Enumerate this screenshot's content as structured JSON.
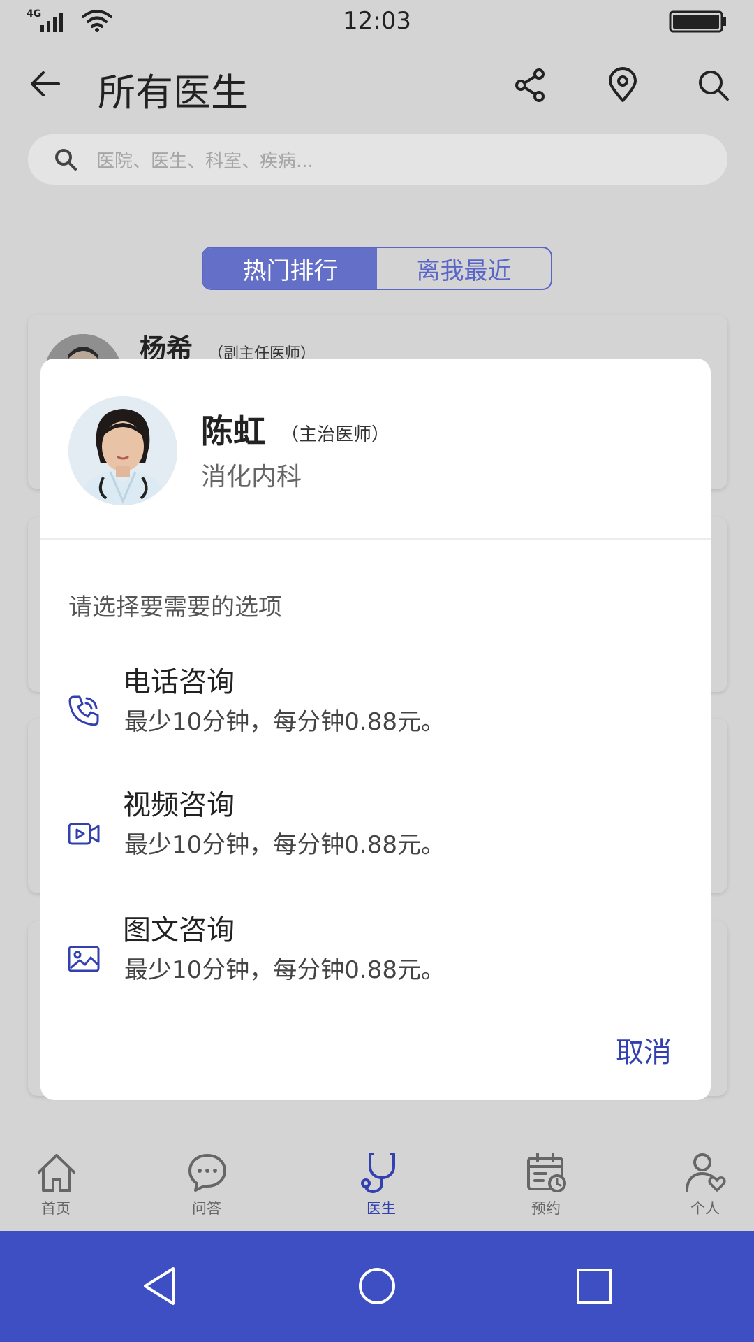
{
  "status_bar": {
    "time": "12:03",
    "network": "4G"
  },
  "header": {
    "title": "所有医生"
  },
  "search": {
    "placeholder": "医院、医生、科室、疾病..."
  },
  "tabs": {
    "hot": "热门排行",
    "nearest": "离我最近"
  },
  "list": {
    "items": [
      {
        "name": "杨希",
        "title": "（副主任医师）"
      }
    ]
  },
  "modal": {
    "doctor_name": "陈虹",
    "doctor_title": "（主治医师）",
    "department": "消化内科",
    "prompt": "请选择要需要的选项",
    "options": [
      {
        "title": "电话咨询",
        "desc": "最少10分钟，每分钟0.88元。",
        "icon": "phone-icon"
      },
      {
        "title": "视频咨询",
        "desc": "最少10分钟，每分钟0.88元。",
        "icon": "video-icon"
      },
      {
        "title": "图文咨询",
        "desc": "最少10分钟，每分钟0.88元。",
        "icon": "image-icon"
      }
    ],
    "cancel": "取消"
  },
  "bottom_nav": {
    "items": [
      {
        "label": "首页",
        "icon": "home-icon"
      },
      {
        "label": "问答",
        "icon": "chat-icon"
      },
      {
        "label": "医生",
        "icon": "stethoscope-icon",
        "active": true
      },
      {
        "label": "预约",
        "icon": "calendar-icon"
      },
      {
        "label": "个人",
        "icon": "user-heart-icon"
      }
    ]
  },
  "colors": {
    "accent": "#3340b0",
    "segment": "#6470c8",
    "navbar": "#3d4fc2",
    "overlay_bg": "#d4d4d4"
  }
}
